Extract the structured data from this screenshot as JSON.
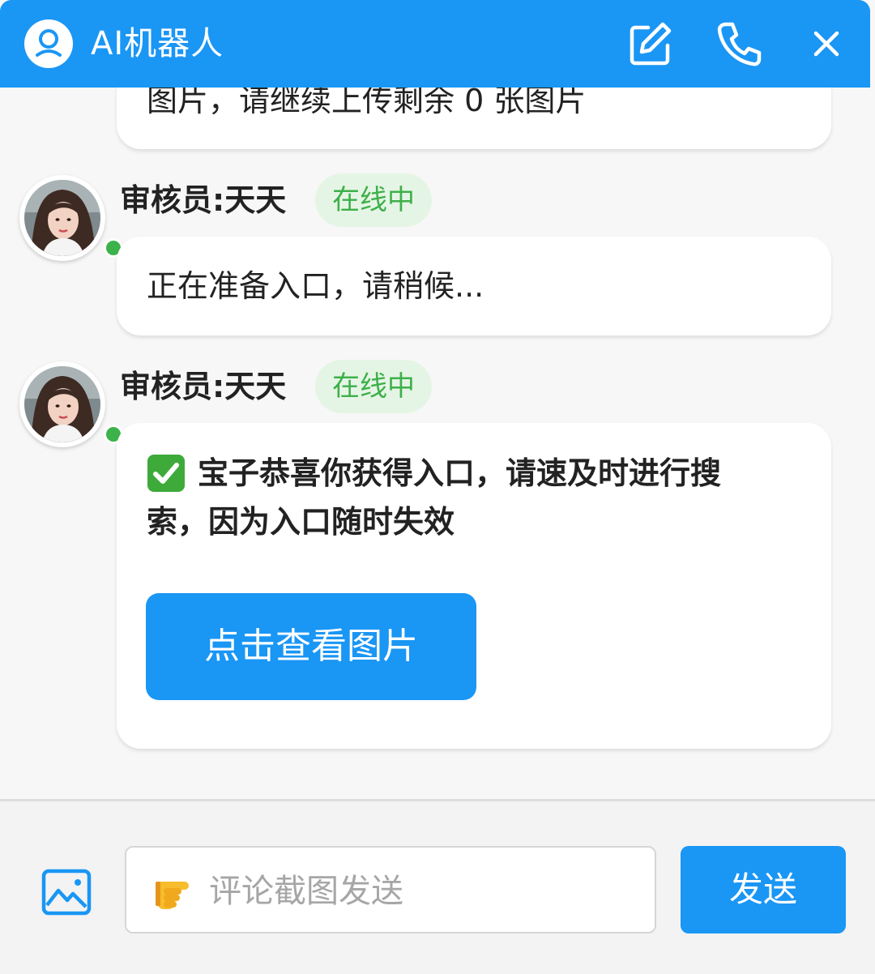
{
  "header": {
    "title": "AI机器人",
    "accent_color": "#1a96f5",
    "icons": [
      "user-circle-icon",
      "edit-icon",
      "phone-icon",
      "close-icon"
    ]
  },
  "messages": [
    {
      "type": "bot",
      "text": "图片，请继续上传剩余 0 张图片"
    },
    {
      "type": "agent",
      "sender": "审核员:天天",
      "status": "在线中",
      "text": "正在准备入口，请稍候..."
    },
    {
      "type": "agent",
      "sender": "审核员:天天",
      "status": "在线中",
      "line1": "宝子恭喜你获得入口，请速及时进行搜",
      "line2": "索，因为入口随时失效",
      "check_icon": "check-mark-icon",
      "button_label": "点击查看图片"
    }
  ],
  "footer": {
    "input_placeholder": "评论截图发送",
    "send_label": "发送",
    "image_icon": "image-upload-icon",
    "pointer_icon": "pointing-hand-icon"
  }
}
